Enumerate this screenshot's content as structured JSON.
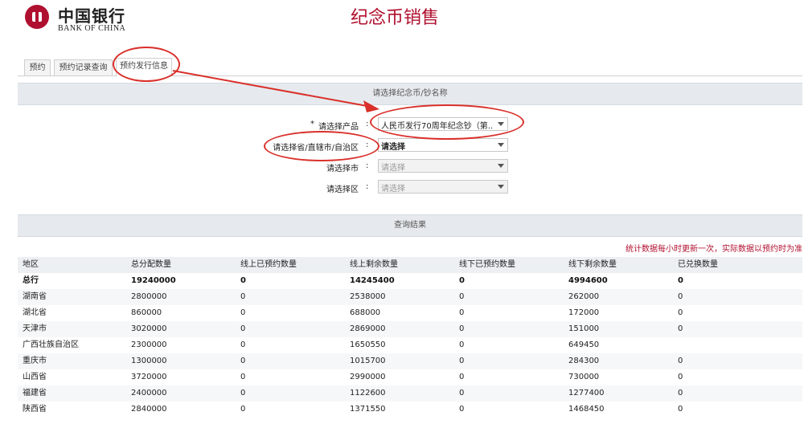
{
  "brand": {
    "name_cn": "中国银行",
    "name_en": "BANK OF CHINA"
  },
  "page_title": "纪念币销售",
  "tabs": [
    {
      "label": "预约"
    },
    {
      "label": "预约记录查询"
    },
    {
      "label": "预约发行信息",
      "active": true
    }
  ],
  "selector_panel": {
    "title": "请选择纪念币/钞名称",
    "fields": [
      {
        "required_mark": "*",
        "label": "请选择产品",
        "value": "人民币发行70周年纪念钞（第...",
        "disabled": false
      },
      {
        "label": "请选择省/直辖市/自治区",
        "value": "请选择",
        "disabled": false
      },
      {
        "label": "请选择市",
        "value": "请选择",
        "disabled": true
      },
      {
        "label": "请选择区",
        "value": "请选择",
        "disabled": true
      }
    ]
  },
  "results_panel": {
    "title": "查询结果",
    "note": "统计数据每小时更新一次，实际数据以预约时为准"
  },
  "table": {
    "columns": [
      "地区",
      "总分配数量",
      "线上已预约数量",
      "线上剩余数量",
      "线下已预约数量",
      "线下剩余数量",
      "已兑换数量"
    ],
    "rows": [
      [
        "总行",
        "19240000",
        "0",
        "14245400",
        "0",
        "4994600",
        "0"
      ],
      [
        "湖南省",
        "2800000",
        "0",
        "2538000",
        "0",
        "262000",
        "0"
      ],
      [
        "湖北省",
        "860000",
        "0",
        "688000",
        "0",
        "172000",
        "0"
      ],
      [
        "天津市",
        "3020000",
        "0",
        "2869000",
        "0",
        "151000",
        "0"
      ],
      [
        "广西壮族自治区",
        "2300000",
        "0",
        "1650550",
        "0",
        "649450",
        ""
      ],
      [
        "重庆市",
        "1300000",
        "0",
        "1015700",
        "0",
        "284300",
        "0"
      ],
      [
        "山西省",
        "3720000",
        "0",
        "2990000",
        "0",
        "730000",
        "0"
      ],
      [
        "福建省",
        "2400000",
        "0",
        "1122600",
        "0",
        "1277400",
        "0"
      ],
      [
        "陕西省",
        "2840000",
        "0",
        "1371550",
        "0",
        "1468450",
        "0"
      ]
    ]
  },
  "colors": {
    "brand_red": "#b0102f",
    "annotation_red": "#d9302a",
    "panel_header_bg": "#e6eaee"
  },
  "icons": {
    "logo": "bank-of-china-logo-icon",
    "dropdown": "chevron-down-icon"
  }
}
